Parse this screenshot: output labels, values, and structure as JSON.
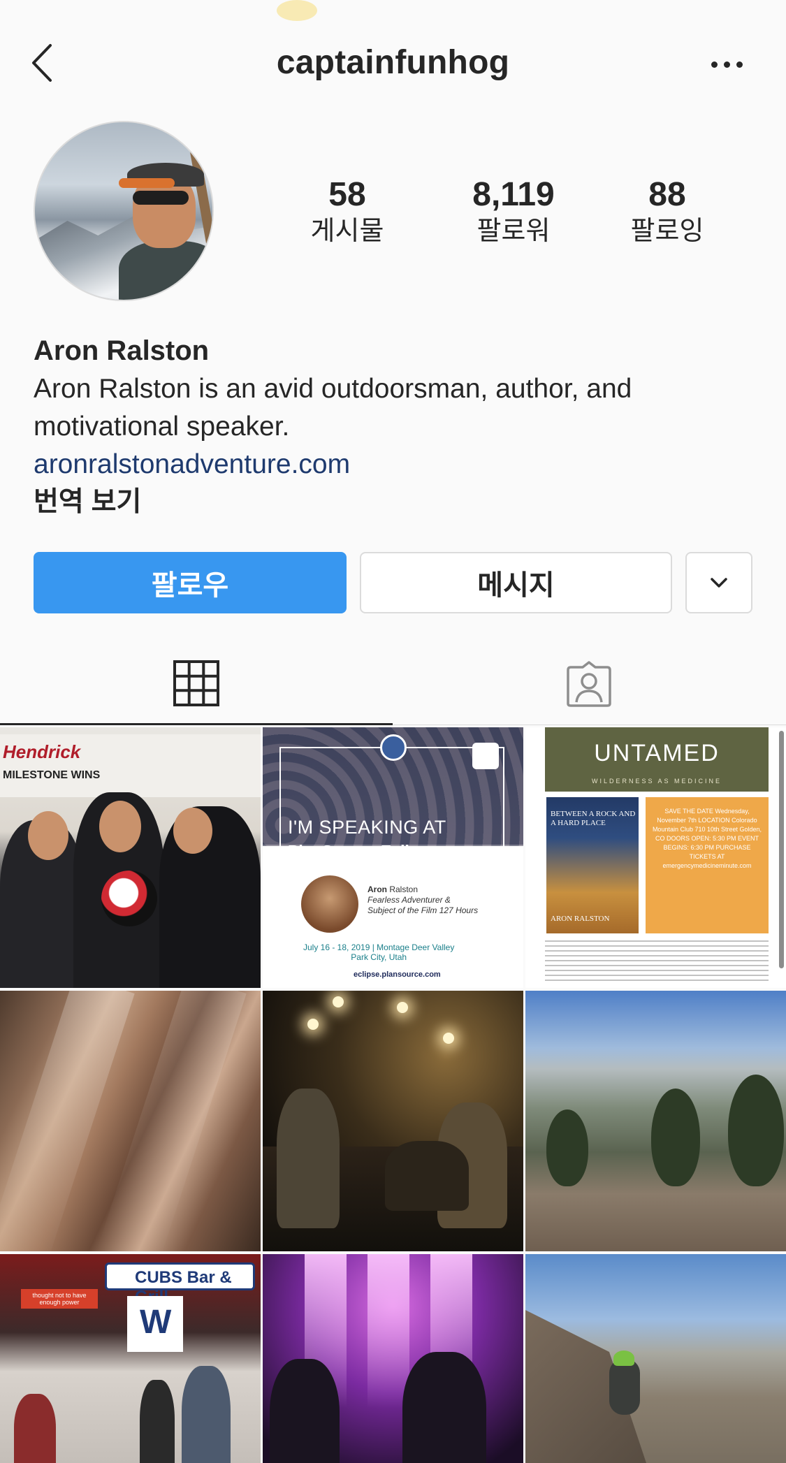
{
  "header": {
    "username": "captainfunhog",
    "back_icon": "chevron-left-icon",
    "more_icon": "more-horizontal-icon"
  },
  "profile": {
    "stats": {
      "posts_count": "58",
      "posts_label": "게시물",
      "followers_count": "8,119",
      "followers_label": "팔로워",
      "following_count": "88",
      "following_label": "팔로잉"
    },
    "name": "Aron Ralston",
    "bio_line1": "Aron Ralston is an avid outdoorsman, author, and",
    "bio_line2": "motivational speaker.",
    "website": "aronralstonadventure.com",
    "translate_label": "번역 보기"
  },
  "actions": {
    "follow_label": "팔로우",
    "message_label": "메시지",
    "dropdown_icon": "chevron-down-icon"
  },
  "colors": {
    "follow_blue": "#3897f0",
    "link_blue": "#1e3a6e",
    "text": "#262626",
    "border": "#dbdbdb"
  },
  "tabs": [
    {
      "name": "grid",
      "icon": "grid-icon",
      "active": true
    },
    {
      "name": "tagged",
      "icon": "tagged-user-icon",
      "active": false
    }
  ],
  "posts": {
    "p1": {
      "brand": "Hendrick",
      "caption": "MILESTONE WINS"
    },
    "p2": {
      "headline": "I'M SPEAKING AT",
      "event": "PlanSource Eclipse",
      "speaker_first": "Aron",
      "speaker_last": "Ralston",
      "speaker_title1": "Fearless Adventurer &",
      "speaker_title2": "Subject of the Film 127 Hours",
      "dates": "July 16 - 18, 2019 | Montage Deer Valley",
      "location": "Park City, Utah",
      "site": "eclipse.plansource.com"
    },
    "p3": {
      "title": "UNTAMED",
      "subtitle": "WILDERNESS AS MEDICINE",
      "book_title": "BETWEEN A ROCK AND A HARD PLACE",
      "book_author": "ARON RALSTON",
      "flyer": "SAVE THE DATE Wednesday, November 7th LOCATION Colorado Mountain Club 710 10th Street Golden, CO DOORS OPEN: 5:30 PM EVENT BEGINS: 6:30 PM PURCHASE TICKETS AT emergencymedicineminute.com"
    },
    "p7": {
      "sign": "CUBS Bar & Grill",
      "flag": "W",
      "led": "thought not to have enough power"
    }
  }
}
